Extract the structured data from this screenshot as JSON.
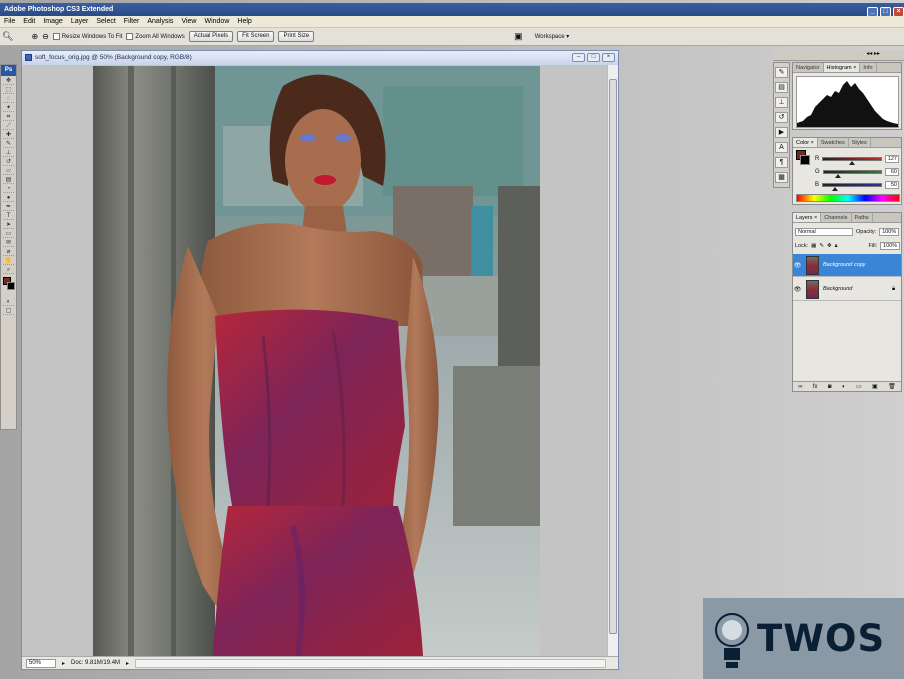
{
  "app": {
    "title": "Adobe Photoshop CS3 Extended"
  },
  "menu": [
    "File",
    "Edit",
    "Image",
    "Layer",
    "Select",
    "Filter",
    "Analysis",
    "View",
    "Window",
    "Help"
  ],
  "options": {
    "resize_label": "Resize Windows To Fit",
    "zoom_all_label": "Zoom All Windows",
    "actual_pixels": "Actual Pixels",
    "fit_screen": "Fit Screen",
    "print_size": "Print Size",
    "workspace": "Workspace ▾"
  },
  "toolbox": {
    "badge": "Ps"
  },
  "document": {
    "title": "soft_focus_orig.jpg @ 50% (Background copy, RGB/8)",
    "zoom": "50%",
    "doc_size": "Doc: 9.81M/19.4M"
  },
  "panels": {
    "histogram_tabs": [
      "Navigator",
      "Histogram ×",
      "Info"
    ],
    "color_tabs": [
      "Color ×",
      "Swatches",
      "Styles"
    ],
    "color": {
      "channels": [
        {
          "name": "R",
          "value": "127",
          "level": 0.5,
          "color": "#c62828"
        },
        {
          "name": "G",
          "value": "60",
          "level": 0.24,
          "color": "#2e7d32"
        },
        {
          "name": "B",
          "value": "50",
          "level": 0.2,
          "color": "#283593"
        }
      ]
    },
    "layers_tabs": [
      "Layers ×",
      "Channels",
      "Paths"
    ],
    "layers": {
      "blend_mode": "Normal",
      "opacity_label": "Opacity:",
      "opacity": "100%",
      "lock_label": "Lock:",
      "fill_label": "Fill:",
      "fill": "100%",
      "items": [
        {
          "name": "Background copy",
          "selected": true
        },
        {
          "name": "Background",
          "selected": false
        }
      ]
    }
  },
  "watermark": {
    "text": "TWOS"
  },
  "colors": {
    "accent": "#3a85d6",
    "titlebar": "#2a4a86"
  }
}
